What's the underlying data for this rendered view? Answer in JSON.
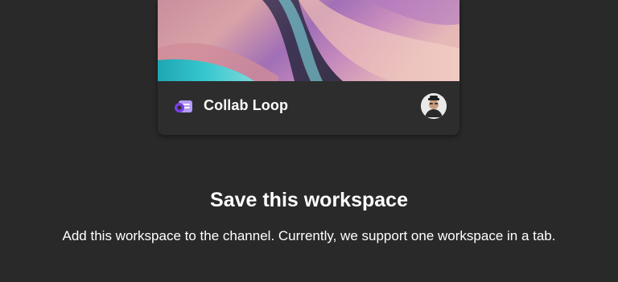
{
  "workspace_card": {
    "title": "Collab Loop",
    "icon": "loop-app-icon",
    "avatar": "user-avatar"
  },
  "dialog": {
    "heading": "Save this workspace",
    "description": "Add this workspace to the channel. Currently, we support one workspace in a tab."
  },
  "colors": {
    "background": "#292929",
    "card": "#2d2d2d",
    "loop_accent": "#8c5cf6",
    "text": "#ffffff"
  }
}
